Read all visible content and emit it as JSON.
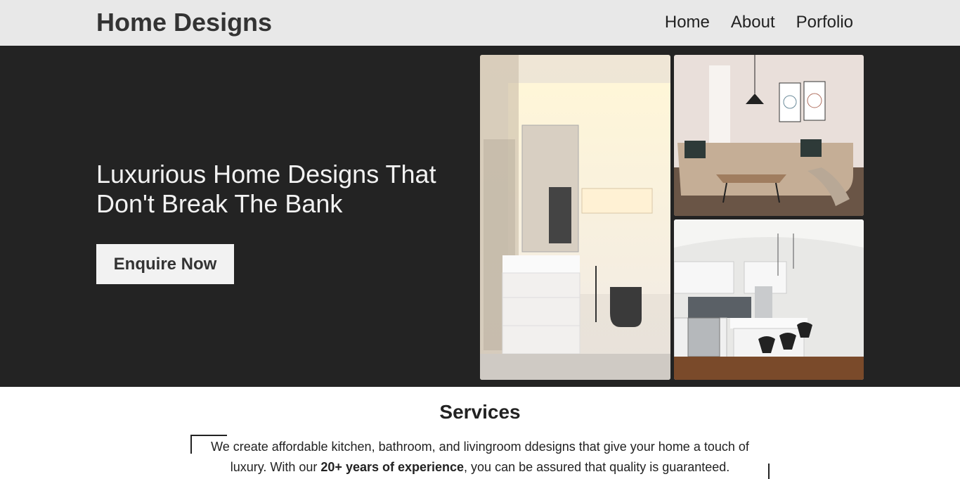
{
  "header": {
    "brand": "Home Designs",
    "nav": [
      {
        "label": "Home"
      },
      {
        "label": "About"
      },
      {
        "label": "Porfolio"
      }
    ]
  },
  "hero": {
    "headline": "Luxurious Home Designs That Don't Break The Bank",
    "cta_label": "Enquire Now",
    "images": [
      "bathroom",
      "living room",
      "kitchen"
    ]
  },
  "services": {
    "title": "Services",
    "text_before": "We create affordable kitchen, bathroom, and livingroom ddesigns that give your home a touch of luxury. With our ",
    "text_bold": "20+ years of experience",
    "text_after": ", you can be assured that quality is guaranteed."
  },
  "colors": {
    "header_bg": "#e8e8e8",
    "hero_bg": "#232323",
    "cta_bg": "#f2f2f2",
    "text_dark": "#222222"
  }
}
